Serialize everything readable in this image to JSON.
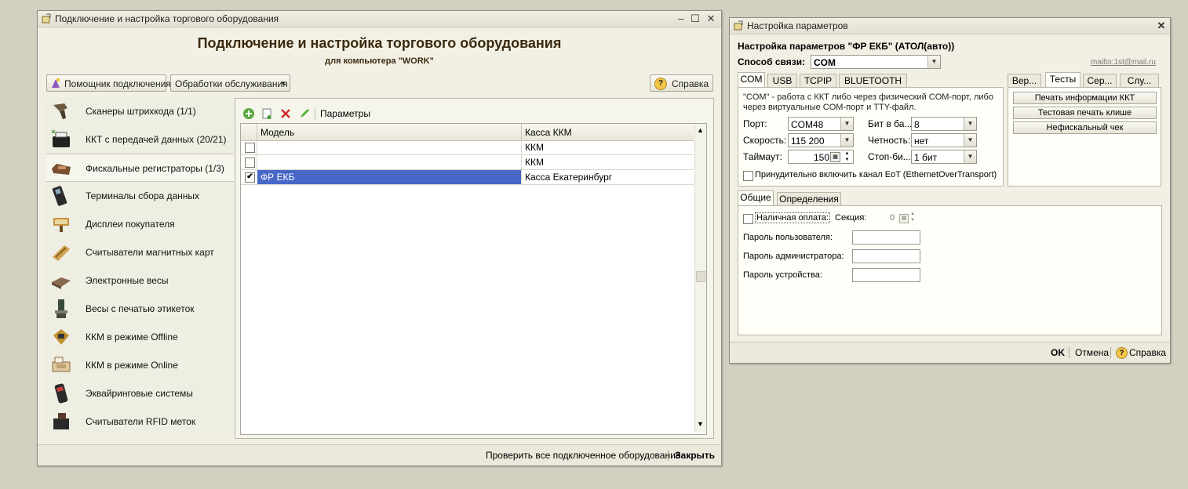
{
  "left_window": {
    "title": "Подключение и настройка торгового оборудования",
    "heading": "Подключение и настройка торгового оборудования",
    "subheading": "для компьютера \"WORK\"",
    "toolbar": {
      "assistant_label": "Помощник подключения",
      "processing_label": "Обработки обслуживания",
      "help_label": "Справка"
    },
    "sidebar": {
      "items": [
        {
          "label": "Сканеры штрихкода (1/1)",
          "icon": "barcode-scanner-icon"
        },
        {
          "label": "ККТ с передачей данных (20/21)",
          "icon": "kkt-printer-icon"
        },
        {
          "label": "Фискальные регистраторы (1/3)",
          "icon": "fiscal-register-icon"
        },
        {
          "label": "Терминалы сбора данных",
          "icon": "data-terminal-icon"
        },
        {
          "label": "Дисплеи покупателя",
          "icon": "customer-display-icon"
        },
        {
          "label": "Считыватели магнитных карт",
          "icon": "card-reader-icon"
        },
        {
          "label": "Электронные весы",
          "icon": "scale-icon"
        },
        {
          "label": "Весы с печатью этикеток",
          "icon": "label-scale-icon"
        },
        {
          "label": "ККМ в режиме Offline",
          "icon": "kkm-offline-icon"
        },
        {
          "label": "ККМ в режиме Online",
          "icon": "kkm-online-icon"
        },
        {
          "label": "Эквайринговые системы",
          "icon": "acquiring-icon"
        },
        {
          "label": "Считыватели RFID меток",
          "icon": "rfid-reader-icon"
        }
      ]
    },
    "grid": {
      "params_label": "Параметры",
      "columns": [
        "Модель",
        "Касса ККМ"
      ],
      "rows": [
        {
          "model": "",
          "kassa": "ККМ",
          "checked": false
        },
        {
          "model": "",
          "kassa": "ККМ",
          "checked": false
        },
        {
          "model": "ФР ЕКБ",
          "kassa": "Касса Екатеринбург",
          "checked": true
        }
      ]
    },
    "footer": {
      "check_all_label": "Проверить все подключенное оборудование",
      "close_label": "Закрыть"
    }
  },
  "right_window": {
    "title": "Настройка параметров",
    "heading": "Настройка параметров \"ФР ЕКБ\" (АТОЛ(авто))",
    "connection_label": "Способ связи:",
    "connection_value": "COM",
    "mailto": "mailto:1st@mail.ru",
    "conn_tabs": [
      "COM",
      "USB",
      "TCPIP",
      "BLUETOOTH"
    ],
    "side_tabs": [
      "Вер...",
      "Тесты",
      "Сер...",
      "Слу..."
    ],
    "com_description": "\"COM\" - работа с ККТ либо через физический COM-порт, либо через виртуальные COM-порт и TTY-файл.",
    "fields": {
      "port_label": "Порт:",
      "port_value": "COM48",
      "speed_label": "Скорость:",
      "speed_value": "115 200",
      "timeout_label": "Таймаут:",
      "timeout_value": "150",
      "databits_label": "Бит в ба...",
      "databits_value": "8",
      "parity_label": "Четность:",
      "parity_value": "нет",
      "stopbits_label": "Стоп-би...",
      "stopbits_value": "1 бит",
      "eot_label": "Принудительно включить канал EoT (EthernetOverTransport)"
    },
    "tests": {
      "print_info": "Печать информации ККТ",
      "test_print": "Тестовая печать клише",
      "nonfiscal": "Нефискальный чек"
    },
    "bottom_tabs": [
      "Общие",
      "Определения"
    ],
    "general": {
      "cash_label": "Наличная оплата:",
      "section_label": "Секция:",
      "section_value": "0",
      "user_pwd_label": "Пароль пользователя:",
      "admin_pwd_label": "Пароль администратора:",
      "device_pwd_label": "Пароль устройства:"
    },
    "footer": {
      "ok_label": "OK",
      "cancel_label": "Отмена",
      "help_label": "Справка"
    }
  }
}
